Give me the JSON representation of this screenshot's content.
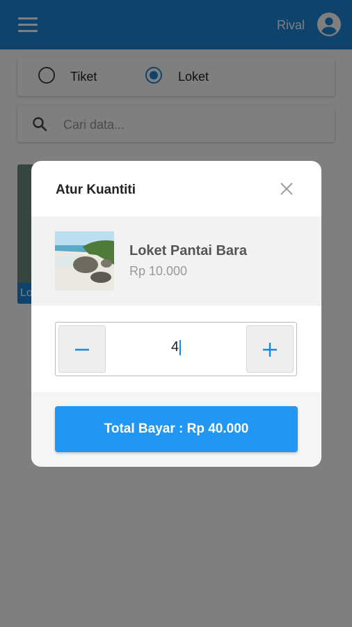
{
  "header": {
    "user_name": "Rival"
  },
  "tabs": {
    "option1": "Tiket",
    "option2": "Loket",
    "selected": "Loket"
  },
  "search": {
    "placeholder": "Cari data..."
  },
  "background_card": {
    "label": "Lo"
  },
  "dialog": {
    "title": "Atur Kuantiti",
    "product_name": "Loket Pantai Bara",
    "product_price": "Rp 10.000",
    "quantity": "4",
    "total_button": "Total Bayar : Rp 40.000"
  },
  "colors": {
    "primary": "#1a87d9",
    "button": "#2196f3"
  }
}
